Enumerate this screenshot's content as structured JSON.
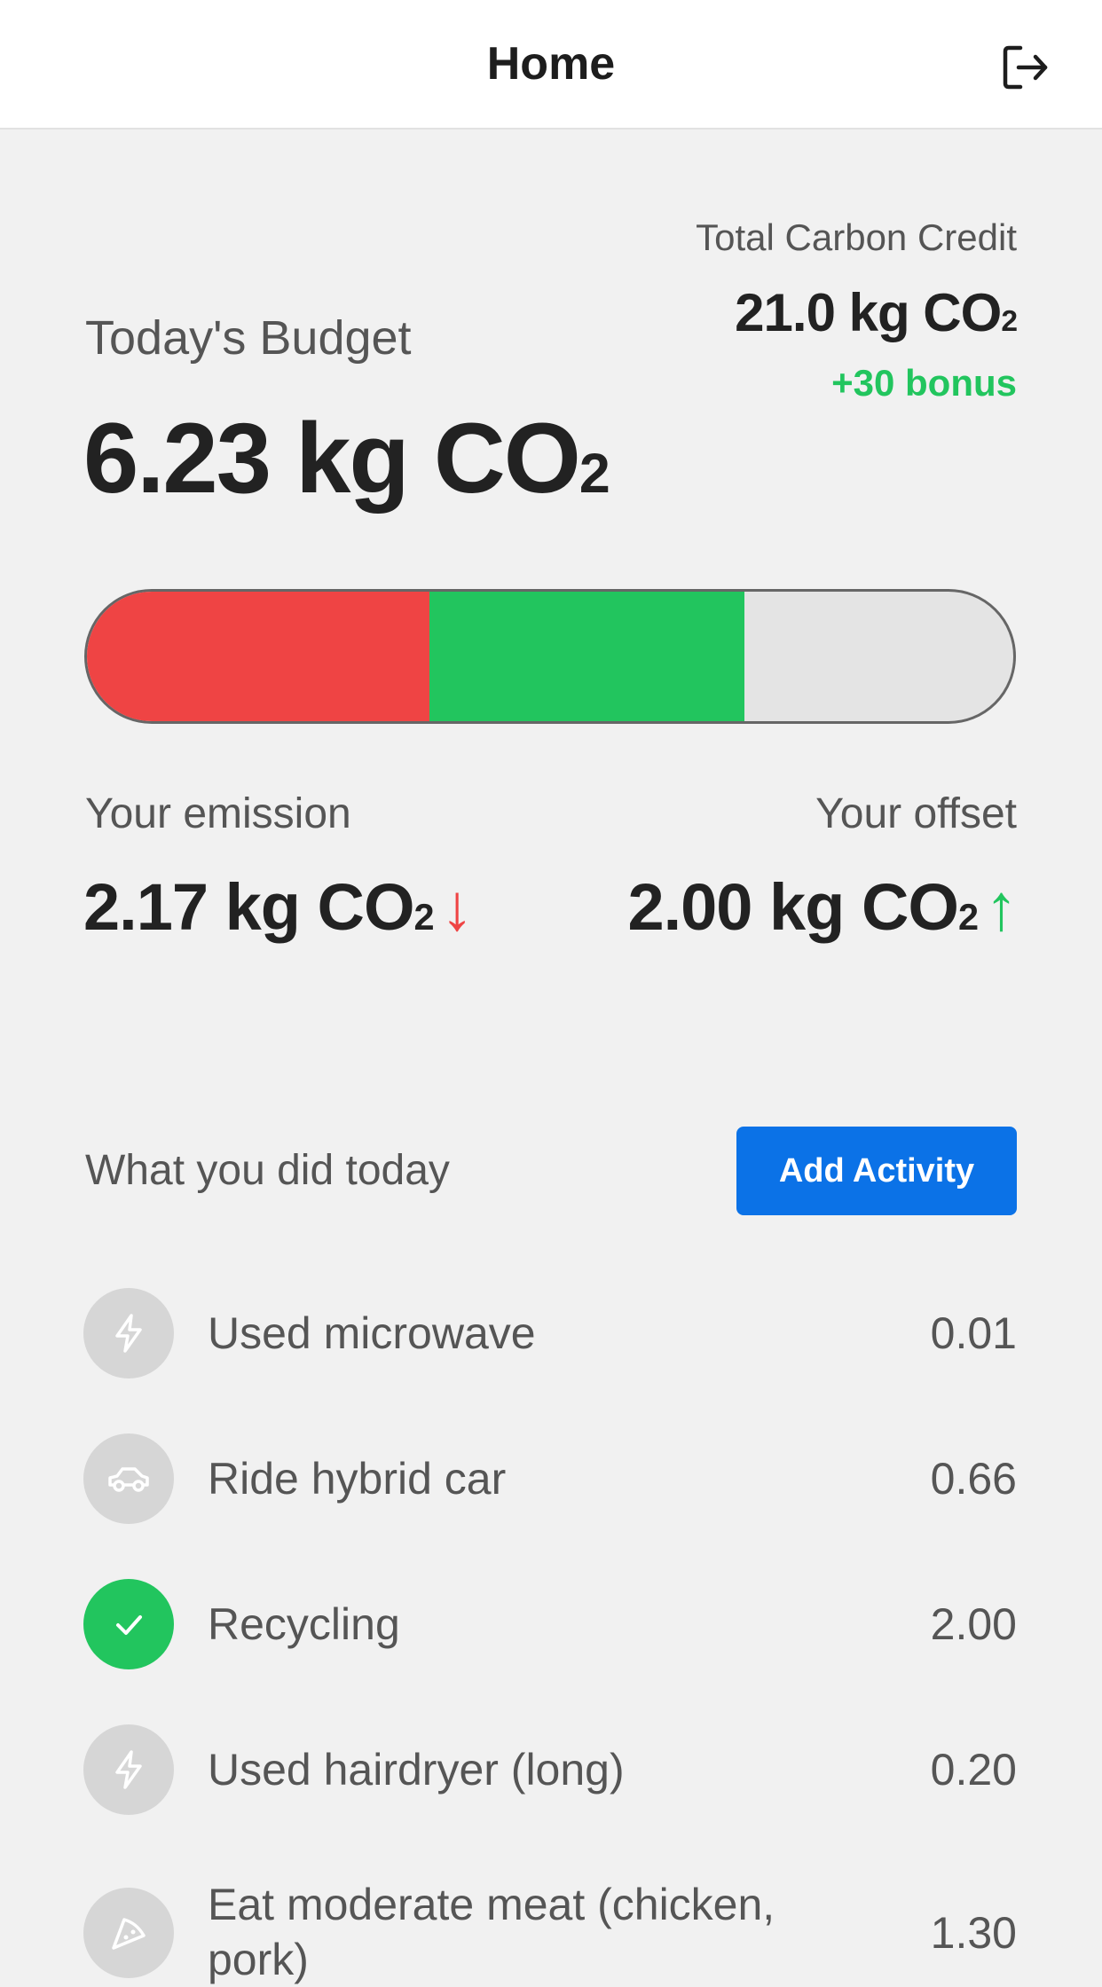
{
  "header": {
    "title": "Home",
    "logout_icon": "logout-icon"
  },
  "credit": {
    "label": "Total Carbon Credit",
    "value": "21.0 kg CO",
    "sub": "2",
    "bonus": "+30 bonus"
  },
  "budget": {
    "label": "Today's Budget",
    "value": "6.23 kg CO",
    "sub": "2"
  },
  "progress": {
    "emission_fraction": 0.37,
    "offset_fraction": 0.34,
    "colors": {
      "emission": "#ef4444",
      "offset": "#22c55e",
      "remaining": "#e4e4e4"
    }
  },
  "emission": {
    "label": "Your emission",
    "value": "2.17 kg CO",
    "sub": "2",
    "arrow": "↓"
  },
  "offset": {
    "label": "Your offset",
    "value": "2.00 kg CO",
    "sub": "2",
    "arrow": "↑"
  },
  "activities": {
    "section_label": "What you did today",
    "add_button": "Add Activity",
    "items": [
      {
        "label": "Used microwave",
        "value": "0.01",
        "icon": "lightning-icon",
        "done": false
      },
      {
        "label": "Ride hybrid car",
        "value": "0.66",
        "icon": "car-icon",
        "done": false
      },
      {
        "label": "Recycling",
        "value": "2.00",
        "icon": "check-icon",
        "done": true
      },
      {
        "label": "Used hairdryer (long)",
        "value": "0.20",
        "icon": "lightning-icon",
        "done": false
      },
      {
        "label": "Eat moderate meat (chicken, pork)",
        "value": "1.30",
        "icon": "pizza-icon",
        "done": false
      }
    ]
  }
}
